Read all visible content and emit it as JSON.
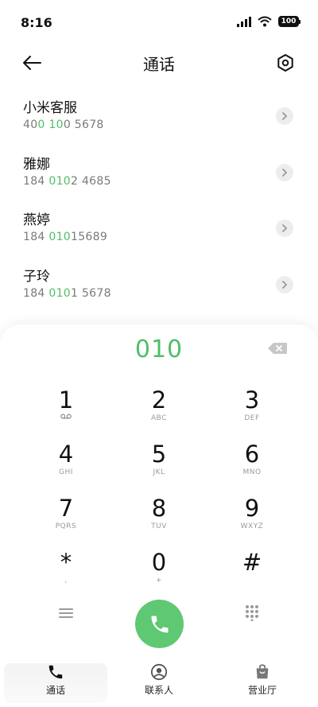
{
  "status": {
    "time": "8:16",
    "battery": "100"
  },
  "header": {
    "title": "通话"
  },
  "results": [
    {
      "name": "小米客服",
      "num_pre": "40",
      "num_hl1": "0",
      "num_mid": " ",
      "num_hl2": "10",
      "num_post": "0 5678"
    },
    {
      "name": "雅娜",
      "num_pre": "184 ",
      "num_hl1": "010",
      "num_mid": "",
      "num_hl2": "",
      "num_post": "2 4685"
    },
    {
      "name": "燕婷",
      "num_pre": "184 ",
      "num_hl1": "010",
      "num_mid": "",
      "num_hl2": "",
      "num_post": "15689"
    },
    {
      "name": "子玲",
      "num_pre": "184 ",
      "num_hl1": "010",
      "num_mid": "",
      "num_hl2": "",
      "num_post": "1 5678"
    }
  ],
  "dial": {
    "input": "010"
  },
  "keys": [
    {
      "digit": "1",
      "letters": ""
    },
    {
      "digit": "2",
      "letters": "ABC"
    },
    {
      "digit": "3",
      "letters": "DEF"
    },
    {
      "digit": "4",
      "letters": "GHI"
    },
    {
      "digit": "5",
      "letters": "JKL"
    },
    {
      "digit": "6",
      "letters": "MNO"
    },
    {
      "digit": "7",
      "letters": "PQRS"
    },
    {
      "digit": "8",
      "letters": "TUV"
    },
    {
      "digit": "9",
      "letters": "WXYZ"
    },
    {
      "digit": "*",
      "letters": ","
    },
    {
      "digit": "0",
      "letters": "+"
    },
    {
      "digit": "#",
      "letters": ""
    }
  ],
  "nav": [
    {
      "label": "通话",
      "icon": "phone-icon",
      "active": true
    },
    {
      "label": "联系人",
      "icon": "contacts-icon",
      "active": false
    },
    {
      "label": "营业厅",
      "icon": "shopping-bag-icon",
      "active": false
    }
  ],
  "colors": {
    "accent": "#4ebe68",
    "call_button": "#5fc872"
  }
}
